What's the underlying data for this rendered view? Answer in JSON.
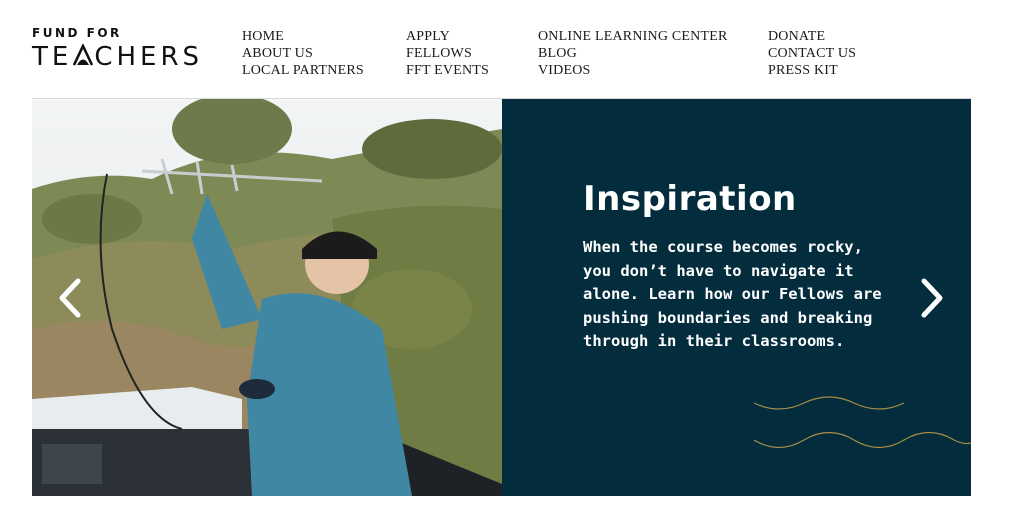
{
  "logo": {
    "top": "FUND FOR",
    "bottom_left": "TE",
    "bottom_right": "CHERS"
  },
  "nav": {
    "col1": [
      "HOME",
      "ABOUT US",
      "LOCAL PARTNERS"
    ],
    "col2": [
      "APPLY",
      "FELLOWS",
      "FFT EVENTS"
    ],
    "col3": [
      "ONLINE LEARNING CENTER",
      "BLOG",
      "VIDEOS"
    ],
    "col4": [
      "DONATE",
      "CONTACT US",
      "PRESS KIT"
    ]
  },
  "slide": {
    "title": "Inspiration",
    "body": "When the course becomes rocky, you don’t have to navigate it alone. Learn how our Fellows are pushing boundaries and breaking through in their classrooms.",
    "photo_icon": "teacher-with-antenna-photo",
    "prev_icon": "chevron-left-icon",
    "next_icon": "chevron-right-icon"
  },
  "colors": {
    "panel": "#032d3c",
    "wave": "#a88c4a",
    "text": "#1a1a1a"
  }
}
